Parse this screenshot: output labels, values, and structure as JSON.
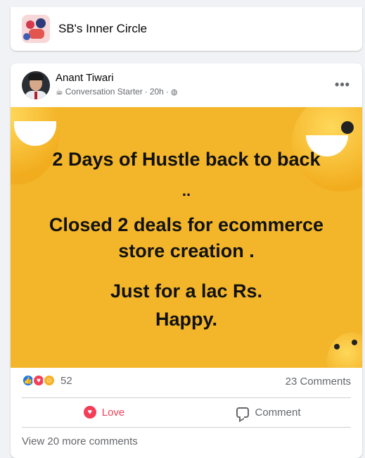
{
  "group": {
    "name": "SB's Inner Circle"
  },
  "post": {
    "author": "Anant Tiwari",
    "badge_icon": "coffee-cup-icon",
    "badge": "Conversation Starter",
    "separator": "·",
    "time": "20h",
    "audience_icon": "globe-icon",
    "more_label": "•••",
    "image_lines": [
      "2 Days of Hustle back to back",
      "..",
      "Closed 2 deals for ecommerce",
      "store creation .",
      "Just for a lac Rs.",
      "Happy."
    ],
    "image_background": "#f3b62a"
  },
  "reactions": {
    "icons": [
      "like-icon",
      "love-icon",
      "care-icon"
    ],
    "count": "52",
    "comments": "23 Comments"
  },
  "actions": {
    "love": "Love",
    "comment": "Comment"
  },
  "comments": {
    "view_more": "View 20 more comments"
  },
  "colors": {
    "love": "#f33e58",
    "like": "#1877f2",
    "secondary_text": "#65676b"
  }
}
